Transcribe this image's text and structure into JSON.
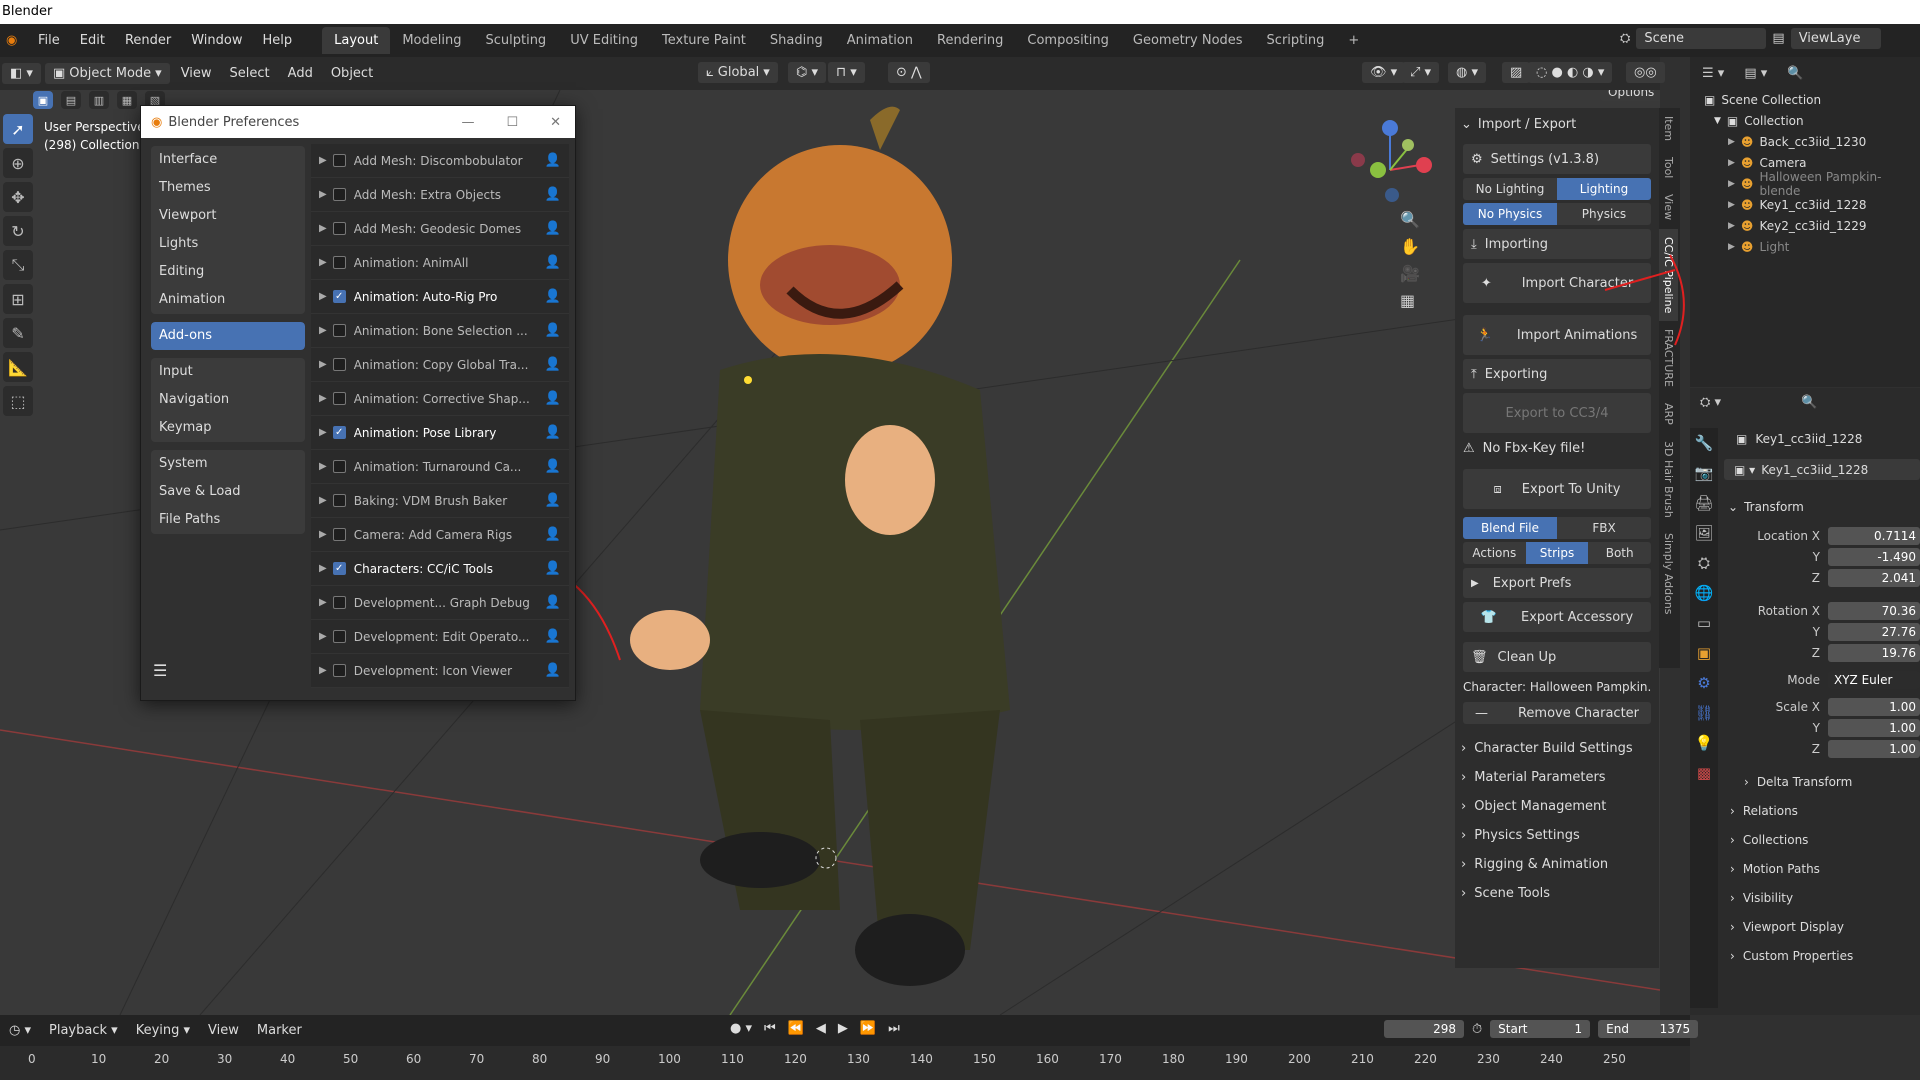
{
  "os_title": "Blender",
  "menu": [
    "File",
    "Edit",
    "Render",
    "Window",
    "Help"
  ],
  "workspaces": [
    "Layout",
    "Modeling",
    "Sculpting",
    "UV Editing",
    "Texture Paint",
    "Shading",
    "Animation",
    "Rendering",
    "Compositing",
    "Geometry Nodes",
    "Scripting"
  ],
  "scene_name": "Scene",
  "view_layer": "ViewLaye",
  "viewport_header": {
    "mode": "Object Mode",
    "menus": [
      "View",
      "Select",
      "Add",
      "Object"
    ],
    "transform": "Global",
    "options": "Options"
  },
  "viewport_info": {
    "perspective": "User Perspective",
    "collection": "(298) Collection |"
  },
  "prefs": {
    "title": "Blender Preferences",
    "nav_groups": [
      [
        "Interface",
        "Themes",
        "Viewport",
        "Lights",
        "Editing",
        "Animation"
      ],
      [
        "Add-ons"
      ],
      [
        "Input",
        "Navigation",
        "Keymap"
      ],
      [
        "System",
        "Save & Load",
        "File Paths"
      ]
    ],
    "addons": [
      {
        "label": "Add Mesh: Discombobulator",
        "on": false
      },
      {
        "label": "Add Mesh: Extra Objects",
        "on": false
      },
      {
        "label": "Add Mesh: Geodesic Domes",
        "on": false
      },
      {
        "label": "Animation: AnimAll",
        "on": false
      },
      {
        "label": "Animation: Auto-Rig Pro",
        "on": true
      },
      {
        "label": "Animation: Bone Selection ...",
        "on": false
      },
      {
        "label": "Animation: Copy Global Tra...",
        "on": false
      },
      {
        "label": "Animation: Corrective Shap...",
        "on": false
      },
      {
        "label": "Animation: Pose Library",
        "on": true
      },
      {
        "label": "Animation: Turnaround Ca...",
        "on": false
      },
      {
        "label": "Baking: VDM Brush Baker",
        "on": false
      },
      {
        "label": "Camera: Add Camera Rigs",
        "on": false
      },
      {
        "label": "Characters: CC/iC Tools",
        "on": true
      },
      {
        "label": "Development... Graph Debug",
        "on": false
      },
      {
        "label": "Development: Edit Operato...",
        "on": false
      },
      {
        "label": "Development: Icon Viewer",
        "on": false
      }
    ]
  },
  "npanel": {
    "header": "Import / Export",
    "settings": "Settings (v1.3.8)",
    "lighting": [
      "No Lighting",
      "Lighting"
    ],
    "physics": [
      "No Physics",
      "Physics"
    ],
    "importing": "Importing",
    "import_character": "Import Character",
    "import_animations": "Import Animations",
    "exporting": "Exporting",
    "export_cc": "Export to CC3/4",
    "no_fbx": "No Fbx-Key file!",
    "export_unity": "Export To Unity",
    "format": [
      "Blend File",
      "FBX"
    ],
    "anim_mode": [
      "Actions",
      "Strips",
      "Both"
    ],
    "export_prefs": "Export Prefs",
    "export_accessory": "Export Accessory",
    "clean_up": "Clean Up",
    "character": "Character: Halloween Pampkin...",
    "remove_character": "Remove Character",
    "sections": [
      "Character Build Settings",
      "Material Parameters",
      "Object Management",
      "Physics Settings",
      "Rigging & Animation",
      "Scene Tools"
    ],
    "tabs": [
      "Item",
      "Tool",
      "View",
      "CC/iC Pipeline",
      "FRACTURE",
      "ARP",
      "3D Hair Brush",
      "Simply Addons"
    ]
  },
  "outliner": {
    "root": "Scene Collection",
    "collection": "Collection",
    "items": [
      "Back_cc3iid_1230",
      "Camera",
      "Halloween Pampkin-blende",
      "Key1_cc3iid_1228",
      "Key2_cc3iid_1229",
      "Light"
    ]
  },
  "props": {
    "object": "Key1_cc3iid_1228",
    "object_data": "Key1_cc3iid_1228",
    "transform": "Transform",
    "location": {
      "label": "Location X",
      "x": "0.7114",
      "y": "-1.490",
      "z": "2.041"
    },
    "rotation": {
      "label": "Rotation X",
      "x": "70.36",
      "y": "27.76",
      "z": "19.76"
    },
    "mode_label": "Mode",
    "mode": "XYZ Euler",
    "scale": {
      "label": "Scale X",
      "x": "1.00",
      "y": "1.00",
      "z": "1.00"
    },
    "axis_y": "Y",
    "axis_z": "Z",
    "delta": "Delta Transform",
    "sections": [
      "Relations",
      "Collections",
      "Motion Paths",
      "Visibility",
      "Viewport Display",
      "Custom Properties"
    ]
  },
  "timeline": {
    "menus": [
      "Playback",
      "Keying",
      "View",
      "Marker"
    ],
    "frame": "298",
    "start_label": "Start",
    "start": "1",
    "end_label": "End",
    "end": "1375",
    "ticks": [
      "0",
      "10",
      "20",
      "30",
      "40",
      "50",
      "60",
      "70",
      "80",
      "90",
      "100",
      "110",
      "120",
      "130",
      "140",
      "150",
      "160",
      "170",
      "180",
      "190",
      "200",
      "210",
      "220",
      "230",
      "240",
      "250"
    ]
  }
}
